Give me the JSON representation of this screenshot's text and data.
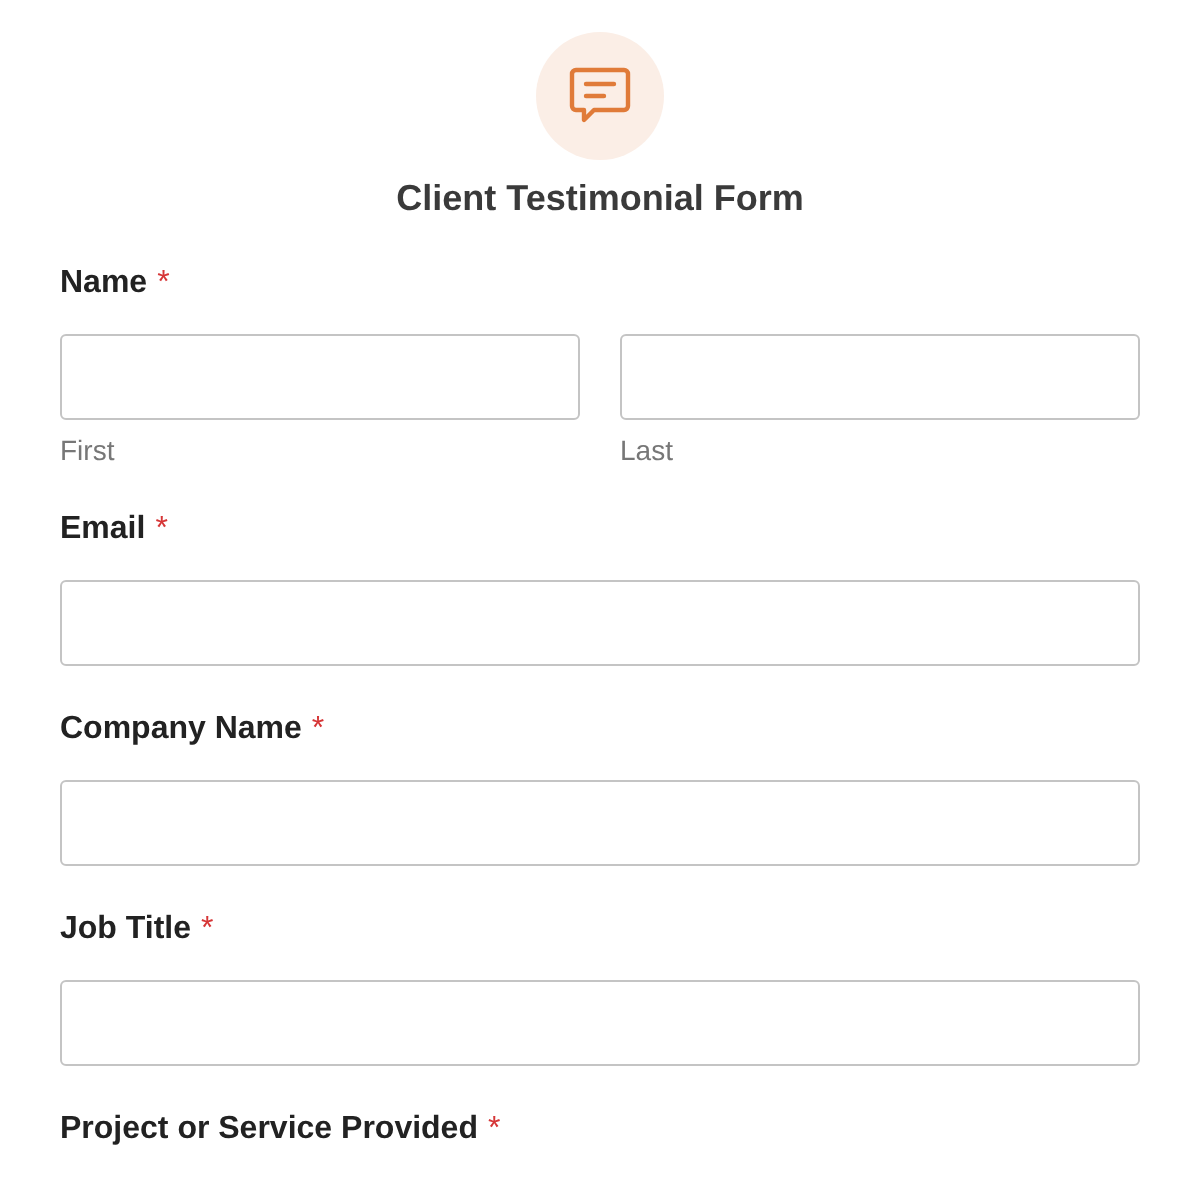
{
  "form": {
    "title": "Client Testimonial Form"
  },
  "fields": [
    {
      "kind": "name-pair",
      "label": "Name",
      "required_mark": "*",
      "sublabels": [
        "First",
        "Last"
      ]
    },
    {
      "kind": "text",
      "label": "Email",
      "required_mark": "*"
    },
    {
      "kind": "text",
      "label": "Company Name",
      "required_mark": "*"
    },
    {
      "kind": "text",
      "label": "Job Title",
      "required_mark": "*"
    },
    {
      "kind": "label-only",
      "label": "Project or Service Provided",
      "required_mark": "*"
    }
  ]
}
